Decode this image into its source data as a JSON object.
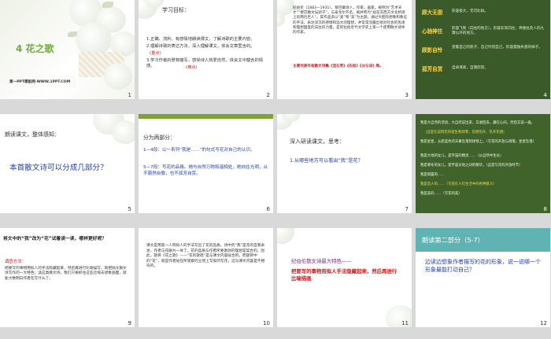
{
  "slides": [
    {
      "num": "1",
      "title": "4 花之歌",
      "site": "第一PPT模板网-WWW.1PPT.COM"
    },
    {
      "num": "2",
      "heading": "学习目标：",
      "lines": [
        "1.正确、流利、有感情地朗读课文，了解诗歌的主要内容。",
        "2.理解诗歌的表达方法，深入理解课文，体会文章里含的。",
        "(重点)",
        "3.学习作者的景物描写，感受诗人热爱自然，体会文中蕴含的情感。",
        "(难点)"
      ]
    },
    {
      "num": "3",
      "text": "纪伯伦（1883—1931），黎巴嫩诗人，作家，画家。被称为“艺术天才”“黎巴嫩文坛骄子”，与泰戈尔齐名，被并称为“站在东西方文化桥梁上的两位巨人”。其作品多以“爱”和“美”为主题，通过大胆的想象和象征的手法，表达深沉的感情和远大的理想，并常常流露出他对社会的忧虑和理想国度的向往的力量，是阿拉伯近代文学史上第一个使用散文诗体的作家。",
      "red": "主要代表作有散文诗集《泪与笑》《先知》《沙与沫》等。"
    },
    {
      "num": "4",
      "terms": [
        {
          "term": "顾大无朋",
          "def": "形容极大，无可比拟。"
        },
        {
          "term": "心驰神往",
          "def": "形容飞到（向往的地方），形容非常向往，神驰往及人的九霄以外的地方。"
        },
        {
          "term": "顾影自怜",
          "def": "望着自己的影子，自己怜惜自己，形容孤独失意的样子。"
        },
        {
          "term": "孤芳自赏",
          "def": "自命清高，自我欣赏。"
        }
      ]
    },
    {
      "num": "5",
      "question": "朗读课文，整体感知：",
      "big": "本首散文诗可以分成几部分？"
    },
    {
      "num": "6",
      "heading": "分为两部分：",
      "p1": "1—4段：以一系列“我是……”的句式写花对自己的认识。",
      "p2": "5—7段：写花的品格。她与自然万物和谐相处，她向往光明，从不藐然自傲，也不孤芳自赏。"
    },
    {
      "num": "7",
      "heading": "深入研读课文，思考：",
      "question": "1.从哪些地方可以看出“我”是花？"
    },
    {
      "num": "8",
      "lines": [
        "我是大自然的话语，大自然说出来，又收回去，藏在心间，然后又说一遍。",
        "（这是在说明花的诞生和凋零，花谢花开、花开花谢）",
        "我是星星，从蔚蓝色的天幕坠落到绿毯上。（写花的开放与凋落，星星坠落）",
        "我是大地的女儿，是宇宙的精灵……（从自然中生长）",
        "我是寒冬的女儿，是宇宙天地之间的精华，（这是写花的开放时节）",
        "我是雨露的……",
        "我是恋人的……（写花在人们生活中的各种意义）",
        "我是美的……（写花的美）"
      ]
    },
    {
      "num": "9",
      "q": "将文中的“我”改为“花”试着读一读，哪样更好呢？",
      "h": "调查方法：",
      "body": "把要写的事物用拟人的手法隐藏起来，然后再进行比喻描写。就把拟化散文诗写作的一大特色；读这类散文诗，我们只要抓住这些比喻去想象画面，就能大致明白作者在写什么了。"
    },
    {
      "num": "10",
      "body": "课文是用第一人称拟人的手法写出了花的品质。诗中的“我”是花的自我表述，作者与花融为一体了。花的品质与作者所要歌颂的理想是契合的。因此，题目《花之歌》——“花的歌唱”是与课文内容贴合的。而题目中的“花”，就是作者站在所观察的立场上写观的写花，这与课文内容是不相符的。"
    },
    {
      "num": "11",
      "line1": "纪伯伦散文诗最大特色——",
      "line2": "把要写的事物用拟人手法隐藏起来，然后再进行比喻描画"
    },
    {
      "num": "12",
      "title": "朗读第二部分（5-7）",
      "q": "边读边想象作者描写的花的形象，说一说哪一个形象最能打动自己？"
    }
  ]
}
